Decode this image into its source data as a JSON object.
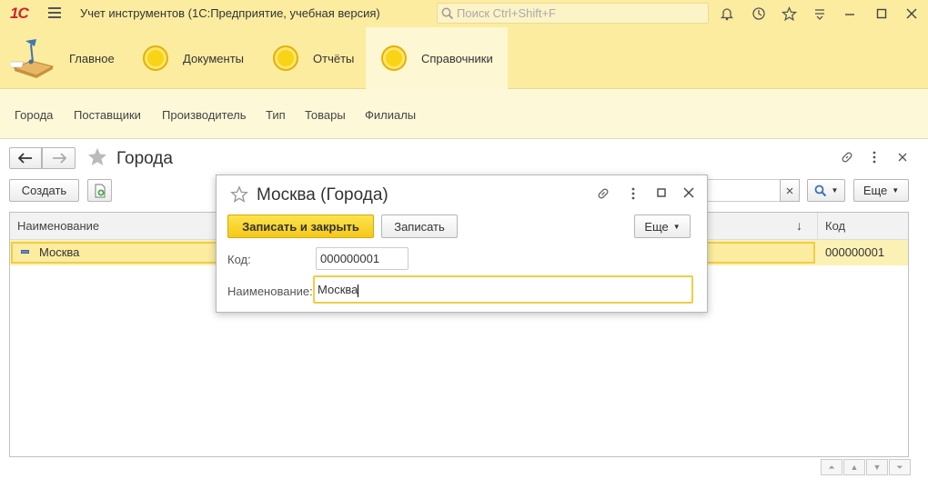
{
  "app": {
    "logo": "1С",
    "title": "Учет инструментов  (1С:Предприятие, учебная версия)",
    "search_placeholder": "Поиск Ctrl+Shift+F"
  },
  "sections": [
    {
      "label": "Главное",
      "icon": "desk-lamp-icon"
    },
    {
      "label": "Документы",
      "icon": "coin-icon"
    },
    {
      "label": "Отчёты",
      "icon": "coin-icon"
    },
    {
      "label": "Справочники",
      "icon": "coin-icon",
      "active": true
    }
  ],
  "nav": [
    "Города",
    "Поставщики",
    "Производитель",
    "Тип",
    "Товары",
    "Филиалы"
  ],
  "form": {
    "title": "Города",
    "create_label": "Создать",
    "more_label": "Еще",
    "columns": {
      "name": "Наименование",
      "code": "Код"
    },
    "rows": [
      {
        "name": "Москва",
        "code": "000000001"
      }
    ]
  },
  "dialog": {
    "title": "Москва (Города)",
    "save_close_label": "Записать и закрыть",
    "save_label": "Записать",
    "more_label": "Еще",
    "code_label": "Код:",
    "code_value": "000000001",
    "name_label": "Наименование:",
    "name_value": "Москва"
  },
  "colors": {
    "panel": "#fbeca0",
    "nav": "#fdf8d8",
    "accent": "#f5c81b"
  }
}
